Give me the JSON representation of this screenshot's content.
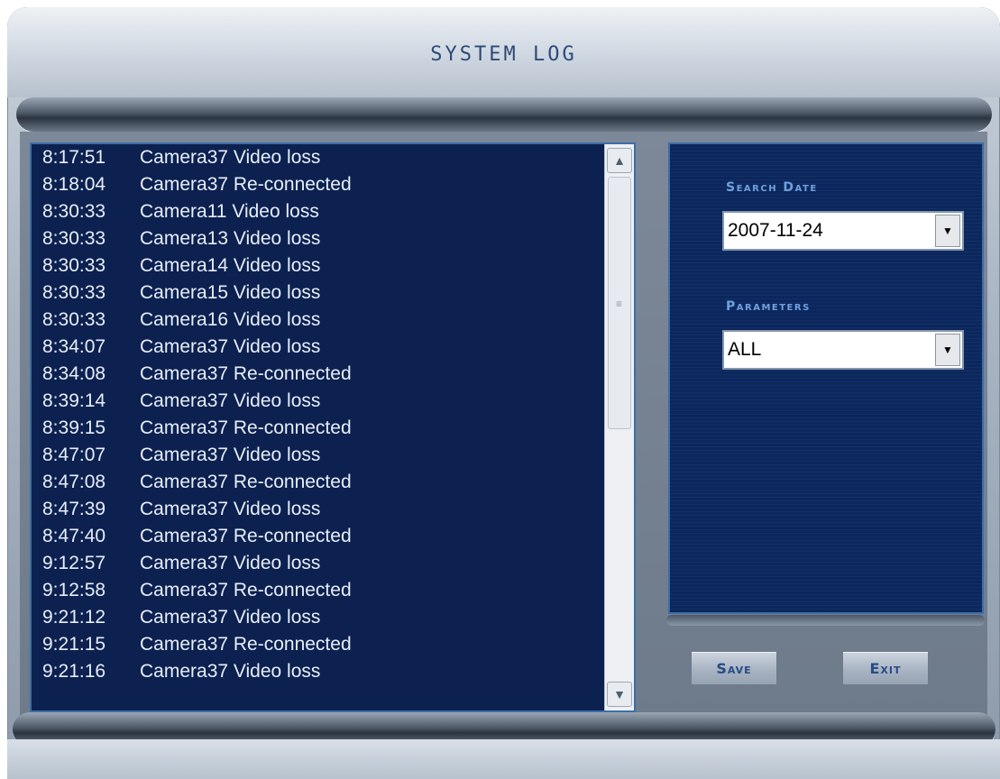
{
  "window": {
    "title": "SYSTEM LOG"
  },
  "log": {
    "entries": [
      {
        "time": "8:17:51",
        "message": "Camera37 Video loss"
      },
      {
        "time": "8:18:04",
        "message": "Camera37 Re-connected"
      },
      {
        "time": "8:30:33",
        "message": "Camera11 Video loss"
      },
      {
        "time": "8:30:33",
        "message": "Camera13 Video loss"
      },
      {
        "time": "8:30:33",
        "message": "Camera14 Video loss"
      },
      {
        "time": "8:30:33",
        "message": "Camera15 Video loss"
      },
      {
        "time": "8:30:33",
        "message": "Camera16 Video loss"
      },
      {
        "time": "8:34:07",
        "message": "Camera37 Video loss"
      },
      {
        "time": "8:34:08",
        "message": "Camera37 Re-connected"
      },
      {
        "time": "8:39:14",
        "message": "Camera37 Video loss"
      },
      {
        "time": "8:39:15",
        "message": "Camera37 Re-connected"
      },
      {
        "time": "8:47:07",
        "message": "Camera37 Video loss"
      },
      {
        "time": "8:47:08",
        "message": "Camera37 Re-connected"
      },
      {
        "time": "8:47:39",
        "message": "Camera37 Video loss"
      },
      {
        "time": "8:47:40",
        "message": "Camera37 Re-connected"
      },
      {
        "time": "9:12:57",
        "message": "Camera37 Video loss"
      },
      {
        "time": "9:12:58",
        "message": "Camera37 Re-connected"
      },
      {
        "time": "9:21:12",
        "message": "Camera37 Video loss"
      },
      {
        "time": "9:21:15",
        "message": "Camera37 Re-connected"
      },
      {
        "time": "9:21:16",
        "message": "Camera37 Video loss"
      }
    ]
  },
  "search": {
    "date_label": "Search Date",
    "date_value": "2007-11-24",
    "parameters_label": "Parameters",
    "parameters_value": "ALL"
  },
  "buttons": {
    "save": "Save",
    "exit": "Exit"
  },
  "icons": {
    "scroll_up": "chevron-up-icon",
    "scroll_down": "chevron-down-icon",
    "dropdown": "triangle-down-icon"
  },
  "colors": {
    "log_background": "#0c2150",
    "accent": "#6fa0df",
    "button_text": "#274b87"
  }
}
